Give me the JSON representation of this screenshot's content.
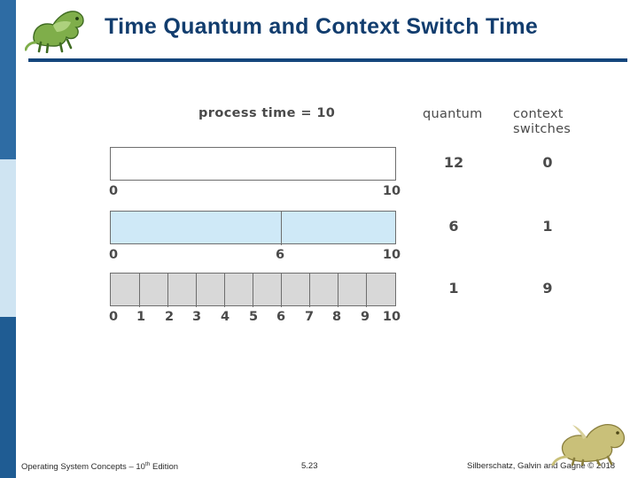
{
  "slide": {
    "title": "Time Quantum and Context Switch Time",
    "accent_color": "#14467c",
    "bar_blue": "#cfe9f7",
    "bar_grey": "#d8d8d8"
  },
  "figure": {
    "process_time_label": "process time = 10",
    "column_headers": {
      "quantum": "quantum",
      "context_switches": "context\nswitches",
      "context_line1": "context",
      "context_line2": "switches"
    },
    "rows": [
      {
        "quantum": "12",
        "context_switches": "0",
        "ticks": [
          "0",
          "10"
        ],
        "dividers": []
      },
      {
        "quantum": "6",
        "context_switches": "1",
        "ticks": [
          "0",
          "6",
          "10"
        ],
        "dividers": [
          "6"
        ]
      },
      {
        "quantum": "1",
        "context_switches": "9",
        "ticks": [
          "0",
          "1",
          "2",
          "3",
          "4",
          "5",
          "6",
          "7",
          "8",
          "9",
          "10"
        ],
        "dividers": [
          "1",
          "2",
          "3",
          "4",
          "5",
          "6",
          "7",
          "8",
          "9"
        ]
      }
    ]
  },
  "footer": {
    "left_text": "Operating System Concepts – 10",
    "left_sup": "th",
    "left_text_end": " Edition",
    "center": "5.23",
    "right": "Silberschatz, Galvin and Gagne © 2018"
  }
}
